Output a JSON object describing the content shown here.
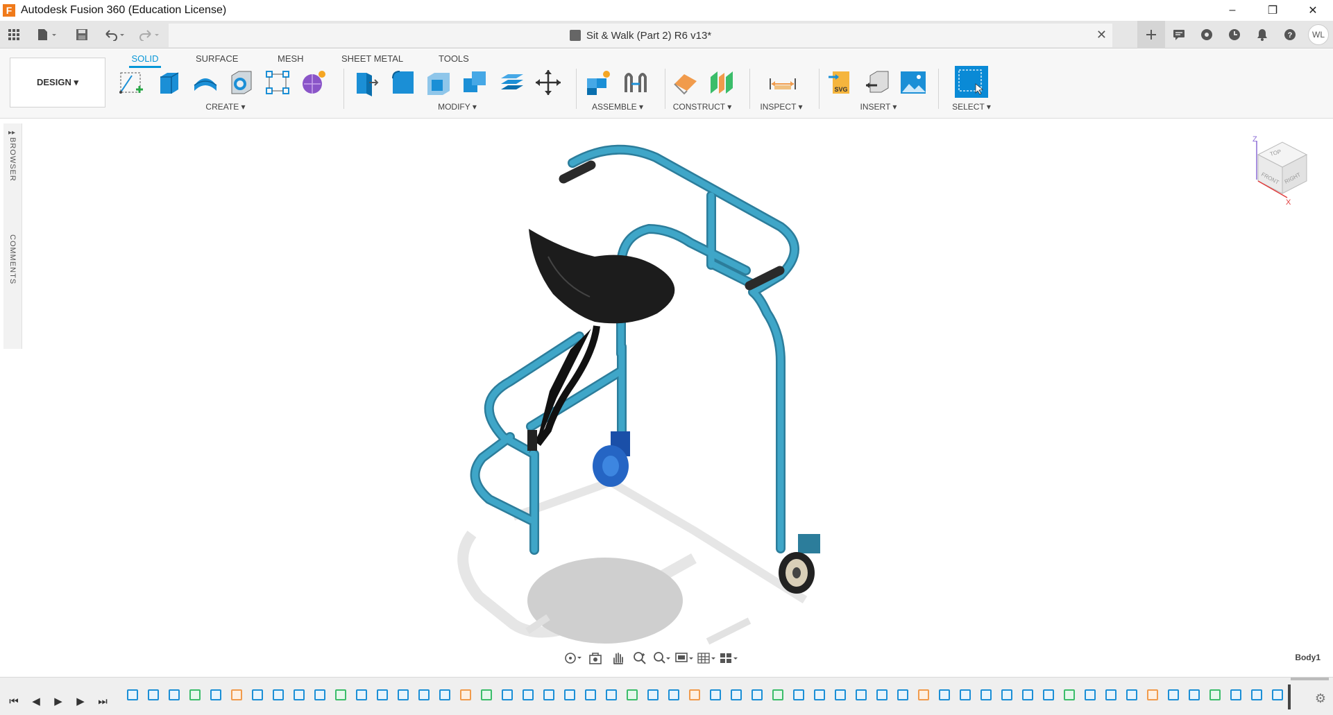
{
  "window": {
    "app_icon_letter": "F",
    "title": "Autodesk Fusion 360 (Education License)",
    "minimize": "–",
    "restore": "❐",
    "close": "✕"
  },
  "document": {
    "tab_title": "Sit & Walk (Part 2) R6 v13*",
    "close_tab": "✕",
    "user_initials": "WL"
  },
  "toolbar": {
    "workspace": "DESIGN ▾",
    "tabs": [
      "SOLID",
      "SURFACE",
      "MESH",
      "SHEET METAL",
      "TOOLS"
    ],
    "active_tab": "SOLID",
    "groups": [
      "CREATE ▾",
      "MODIFY ▾",
      "ASSEMBLE ▾",
      "CONSTRUCT ▾",
      "INSPECT ▾",
      "INSERT ▾",
      "SELECT ▾"
    ]
  },
  "side_panel": {
    "browser": "BROWSER",
    "comments": "COMMENTS"
  },
  "viewcube": {
    "top": "TOP",
    "front": "FRONT",
    "right": "RIGHT",
    "axis_z": "Z",
    "axis_x": "X"
  },
  "viewport": {
    "active_body": "Body1"
  },
  "colors": {
    "accent": "#0696d7",
    "frame_tube": "#3a9bbd",
    "seat": "#1c1c1c",
    "wheel_front": "#2565c4"
  }
}
